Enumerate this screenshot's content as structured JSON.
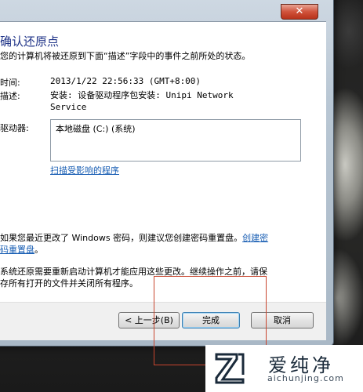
{
  "window": {
    "close_glyph": "✕",
    "title": "确认还原点",
    "subtitle": "您的计算机将被还原到下面“描述”字段中的事件之前所处的状态。"
  },
  "details": {
    "time_label": "时间:",
    "time_value": "2013/1/22 22:56:33 (GMT+8:00)",
    "desc_label": "描述:",
    "desc_value_line1": "安装: 设备驱动程序包安装: Unipi Network",
    "desc_value_line2": "Service",
    "drives_label": "驱动器:",
    "drives": [
      "本地磁盘 (C:) (系统)"
    ],
    "scan_link": "扫描受影响的程序"
  },
  "notes": {
    "password_text": "如果您最近更改了 Windows 密码，则建议您创建密码重置盘。",
    "password_link_part1": "创建密",
    "password_link_part2": "码重置盘",
    "password_end": "。",
    "restart_line1": "系统还原需要重新启动计算机才能应用这些更改。继续操作之前，请保",
    "restart_line2": "存所有打开的文件并关闭所有程序。"
  },
  "buttons": {
    "back": "< 上一步(B)",
    "finish": "完成",
    "cancel": "取消"
  },
  "watermark": {
    "cn": "爱纯净",
    "en": "aichunjing.com"
  },
  "colors": {
    "title": "#1e3287",
    "link": "#1a5fb4",
    "annotation": "#c8452e"
  }
}
